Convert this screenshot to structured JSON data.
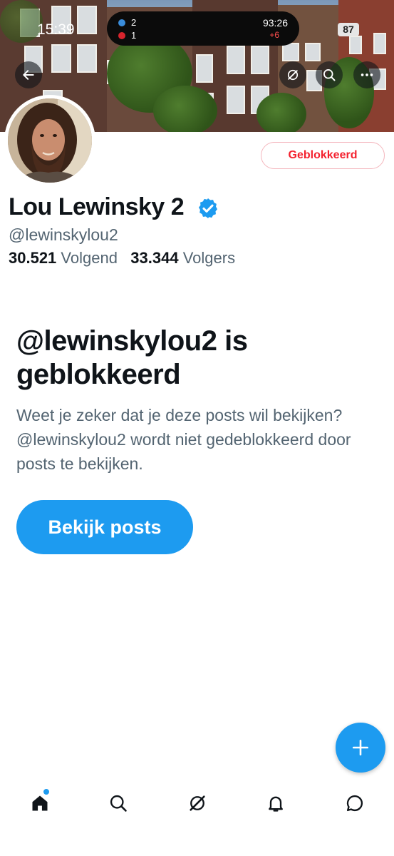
{
  "status_bar": {
    "time": "15:39",
    "battery": "87",
    "live_score": {
      "home_score": "2",
      "away_score": "1",
      "match_time": "93:26",
      "added_time": "+6"
    }
  },
  "header": {
    "back_icon": "arrow-left-icon",
    "grok_icon": "grok-icon",
    "search_icon": "search-icon",
    "more_icon": "more-horizontal-icon"
  },
  "profile": {
    "display_name": "Lou Lewinsky 2",
    "handle": "@lewinskylou2",
    "blocked_button_label": "Geblokkeerd",
    "following_count": "30.521",
    "following_label": "Volgend",
    "followers_count": "33.344",
    "followers_label": "Volgers",
    "verified": true
  },
  "blocked_notice": {
    "title": "@lewinskylou2 is geblokkeerd",
    "body": "Weet je zeker dat je deze posts wil bekijken? @lewinskylou2 wordt niet gedeblokkeerd door posts te bekijken.",
    "button_label": "Bekijk posts"
  },
  "bottom_nav": {
    "items": [
      "home-icon",
      "search-icon",
      "grok-icon",
      "notifications-icon",
      "messages-icon"
    ],
    "home_has_badge": true
  },
  "colors": {
    "accent": "#1d9bf0",
    "blocked_red": "#f4212e",
    "secondary_text": "#536471"
  }
}
